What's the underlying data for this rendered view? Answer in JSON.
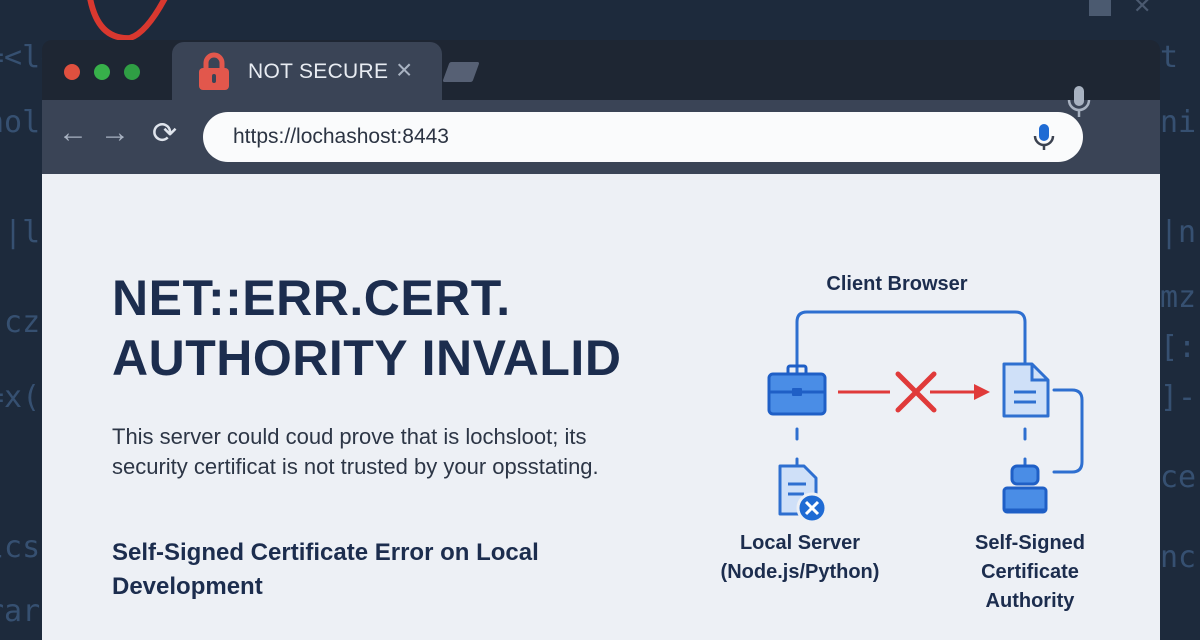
{
  "background_code": {
    "left": [
      "=<le",
      "nol",
      ")|l",
      ".cz",
      "=x(",
      "lcs",
      "rar"
    ],
    "right": [
      "t",
      "ni",
      "|n",
      "mz",
      "[:",
      "]-(",
      "ce",
      "nc"
    ]
  },
  "colors": {
    "traffic_red": "#e0503f",
    "traffic_green_1": "#37b04a",
    "traffic_green_2": "#2f9e44",
    "lock_red": "#e2574c",
    "accent_blue": "#2e6fd0",
    "error_red": "#e03a3a"
  },
  "tab": {
    "title": "NOT SECURE",
    "close_icon": "×"
  },
  "toolbar": {
    "back_icon": "←",
    "forward_icon": "→",
    "reload_icon": "⟳",
    "url": "https://lochashost:8443"
  },
  "error": {
    "title_line1": "NET::ERR.CERT.",
    "title_line2": "AUTHORITY INVALID",
    "description_line1": "This server could coud prove that is lochsloot; its",
    "description_line2": "security certificat is not trusted by your opsstating.",
    "subtitle_line1": "Self-Signed Certificate Error on Local",
    "subtitle_line2": "Development"
  },
  "diagram": {
    "client_label": "Client Browser",
    "server_label_line1": "Local Server",
    "server_label_line2": "(Node.js/Python)",
    "ca_label_line1": "Self-Signed",
    "ca_label_line2": "Certificate",
    "ca_label_line3": "Authority"
  }
}
